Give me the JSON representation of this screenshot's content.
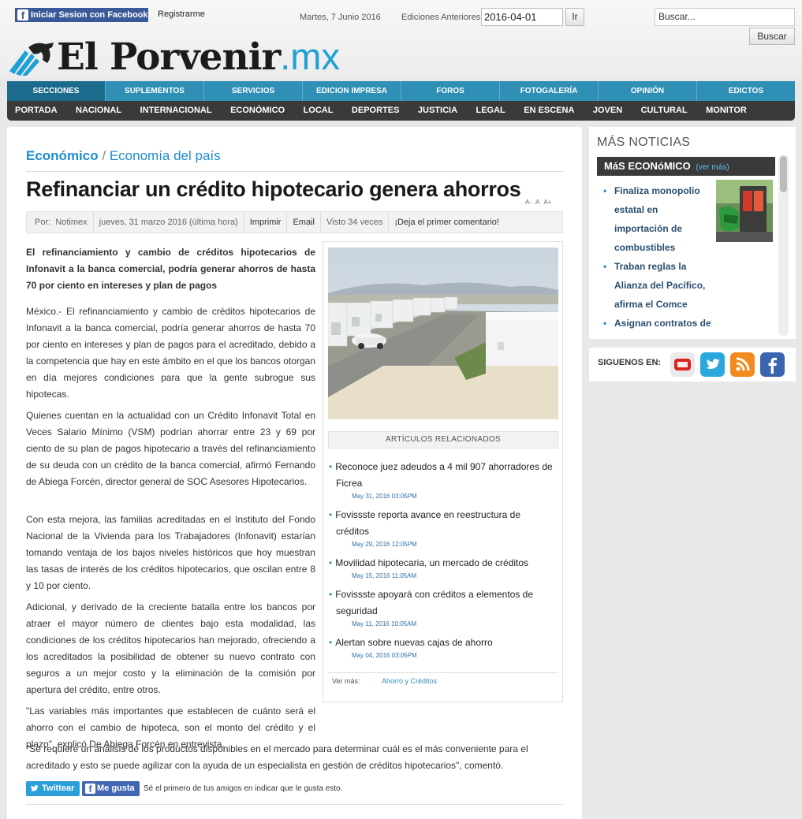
{
  "topbar": {
    "facebook_login": "Iniciar Sesion con Facebook",
    "register": "Registrarme",
    "date": "Martes, 7 Junio 2016",
    "editions_label": "Ediciones Anteriores",
    "edition_date_value": "2016-04-01",
    "go_button": "Ir",
    "search_placeholder": "Buscar...",
    "search_button": "Buscar"
  },
  "logo": {
    "main": "El Porvenir",
    "suffix": ".mx"
  },
  "main_nav": [
    "SECCIONES",
    "SUPLEMENTOS",
    "SERVICIOS",
    "EDICION IMPRESA",
    "FOROS",
    "FOTOGALERÍA",
    "OPINIÓN",
    "EDICTOS"
  ],
  "sub_nav": [
    "PORTADA",
    "NACIONAL",
    "INTERNACIONAL",
    "ECONÓMICO",
    "LOCAL",
    "DEPORTES",
    "JUSTICIA",
    "LEGAL",
    "EN ESCENA",
    "JOVEN",
    "CULTURAL",
    "MONITOR"
  ],
  "article": {
    "section": "Económico",
    "separator": "/",
    "subsection": "Economía del país",
    "title": "Refinanciar un crédito hipotecario genera ahorros",
    "font_controls": [
      "A-",
      "A",
      "A+"
    ],
    "meta": {
      "by_label": "Por:",
      "author": "Notimex",
      "date": "jueves, 31 marzo 2016 (última hora)",
      "print": "Imprimir",
      "email": "Email",
      "views": "Visto 34 veces",
      "comment": "¡Deja el primer comentario!"
    },
    "lead": "El refinanciamiento y cambio de créditos hipotecarios de Infonavit a la banca comercial, podría generar ahorros de hasta 70 por ciento en intereses y plan de pagos",
    "paragraphs": [
      "México.- El refinanciamiento y cambio de créditos hipotecarios de Infonavit a la banca comercial, podría generar ahorros de hasta 70 por ciento en intereses y plan de pagos para el acreditado, debido a la competencia que hay en este ámbito en el que los bancos otorgan en día mejores condiciones para que la gente subrogue sus hipotecas.",
      "Quienes cuentan en la actualidad con un Crédito Infonavit Total en Veces Salario Mínimo (VSM) podrían ahorrar entre 23 y 69 por ciento de su plan de pagos hipotecario a través del refinanciamiento de su deuda con un crédito de la banca comercial, afirmó Fernando de Abiega Forcén, director general de SOC Asesores Hipotecarios.",
      "Con esta mejora, las familias acreditadas en el Instituto del Fondo Nacional de la Vivienda para los Trabajadores (Infonavit) estarían tomando ventaja de los bajos niveles históricos que hoy muestran las tasas de interés de los créditos hipotecarios, que oscilan entre 8 y 10 por ciento.",
      "Adicional, y derivado de la creciente batalla entre los bancos por atraer el mayor número de clientes bajo esta modalidad, las condiciones de los créditos hipotecarios han mejorado, ofreciendo a los acreditados la posibilidad de obtener su nuevo contrato con seguros a un mejor costo y la eliminación de la comisión por apertura del crédito, entre otros.",
      "\"Las variables más importantes que establecen de cuánto será el ahorro con el cambio de hipoteca, son el monto del crédito y el plazo\", explicó De Abiega Forcén en entrevista.",
      "\"Se requiere un análisis de los productos disponibles en el mercado para determinar cuál es el más conveniente para el acreditado y esto se puede agilizar con la ayuda de un especialista en gestión de créditos hipotecarios\", comentó."
    ]
  },
  "related": {
    "heading": "ARTÍCULOS RELACIONADOS",
    "items": [
      {
        "title": "Reconoce juez adeudos a 4 mil 907 ahorradores de Ficrea",
        "date": "May 31, 2016 03:05PM"
      },
      {
        "title": "Fovissste reporta avance en reestructura de créditos",
        "date": "May 29, 2016 12:05PM"
      },
      {
        "title": "Movilidad hipotecaria, un mercado de créditos",
        "date": "May 15, 2016 11:05AM"
      },
      {
        "title": "Fovissste apoyará con créditos a elementos de seguridad",
        "date": "May 11, 2016 10:05AM"
      },
      {
        "title": "Alertan sobre nuevas cajas de ahorro",
        "date": "May 04, 2016 03:05PM"
      }
    ],
    "see_more_label": "Ver más:",
    "see_more_link": "Ahorro y Créditos"
  },
  "social": {
    "tweet": "Twittear",
    "like": "Me gusta",
    "like_text": "Sé el primero de tus amigos en indicar que le gusta esto."
  },
  "sidebar": {
    "title": "MÁS NOTICIAS",
    "section_head": "MáS ECONóMICO",
    "see_more": "(ver más)",
    "items": [
      "Finaliza monopolio estatal en importación de combustibles",
      "Traban reglas la Alianza del Pacífico, afirma el Comce",
      "Asignan contratos de"
    ],
    "follow_label": "SIGUENOS EN:",
    "follow_icons": [
      "youtube-icon",
      "twitter-icon",
      "rss-icon",
      "facebook-icon"
    ]
  },
  "colors": {
    "accent": "#2f8fb5",
    "nav_dark": "#3a3a3a",
    "link": "#1e8dd0",
    "facebook": "#3b5998"
  }
}
